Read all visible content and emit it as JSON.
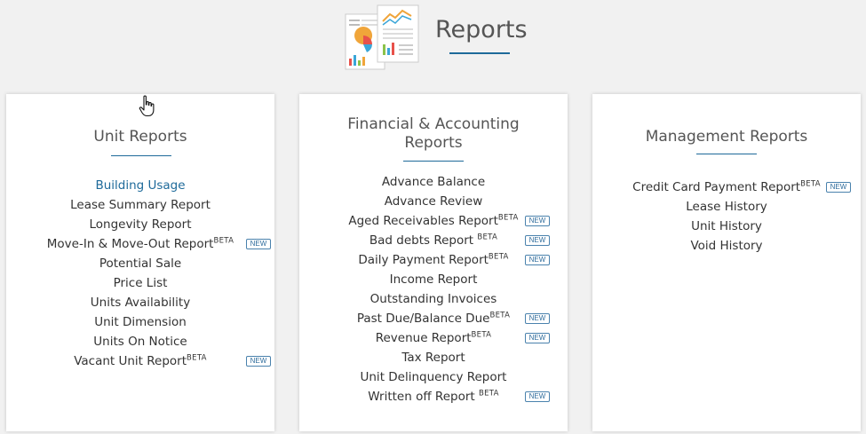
{
  "header": {
    "title": "Reports"
  },
  "badges": {
    "new": "NEW",
    "beta": "BETA"
  },
  "cards": [
    {
      "title_lines": [
        "Unit Reports"
      ],
      "items": [
        {
          "label": "Building Usage",
          "beta": false,
          "new": false
        },
        {
          "label": "Lease Summary Report",
          "beta": false,
          "new": false
        },
        {
          "label": "Longevity Report",
          "beta": false,
          "new": false
        },
        {
          "label": "Move-In & Move-Out Report",
          "beta": true,
          "new": true
        },
        {
          "label": "Potential Sale",
          "beta": false,
          "new": false
        },
        {
          "label": "Price List",
          "beta": false,
          "new": false
        },
        {
          "label": "Units Availability",
          "beta": false,
          "new": false
        },
        {
          "label": "Unit Dimension",
          "beta": false,
          "new": false
        },
        {
          "label": "Units On Notice",
          "beta": false,
          "new": false
        },
        {
          "label": "Vacant Unit Report",
          "beta": true,
          "new": true
        }
      ]
    },
    {
      "title_lines": [
        "Financial & Accounting",
        "Reports"
      ],
      "items": [
        {
          "label": "Advance Balance",
          "beta": false,
          "new": false
        },
        {
          "label": "Advance Review",
          "beta": false,
          "new": false
        },
        {
          "label": "Aged Receivables Report",
          "beta": true,
          "new": true
        },
        {
          "label": "Bad debts Report ",
          "beta": true,
          "new": true
        },
        {
          "label": "Daily Payment Report",
          "beta": true,
          "new": true
        },
        {
          "label": "Income Report",
          "beta": false,
          "new": false
        },
        {
          "label": "Outstanding Invoices",
          "beta": false,
          "new": false
        },
        {
          "label": "Past Due/Balance Due",
          "beta": true,
          "new": true
        },
        {
          "label": "Revenue Report",
          "beta": true,
          "new": true
        },
        {
          "label": "Tax Report",
          "beta": false,
          "new": false
        },
        {
          "label": "Unit Delinquency Report",
          "beta": false,
          "new": false
        },
        {
          "label": "Written off Report ",
          "beta": true,
          "new": true
        }
      ]
    },
    {
      "title_lines": [
        "Management Reports"
      ],
      "items": [
        {
          "label": "Credit Card Payment Report",
          "beta": true,
          "new": true
        },
        {
          "label": "Lease History",
          "beta": false,
          "new": false
        },
        {
          "label": "Unit History",
          "beta": false,
          "new": false
        },
        {
          "label": "Void History",
          "beta": false,
          "new": false
        }
      ]
    }
  ]
}
